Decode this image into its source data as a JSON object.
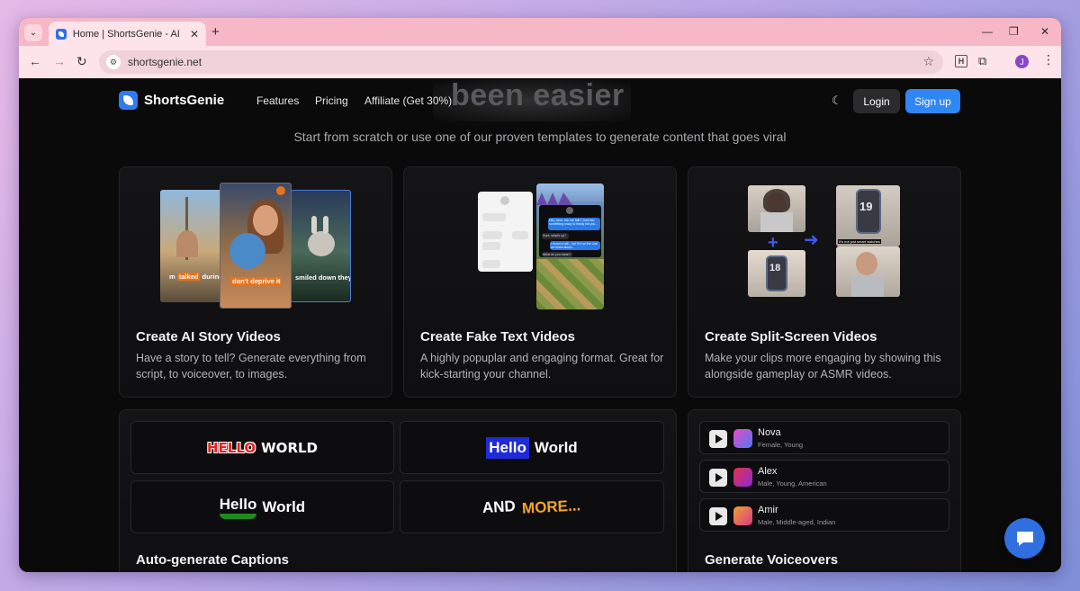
{
  "browser": {
    "tab_title": "Home | ShortsGenie - AI Video",
    "url": "shortsgenie.net",
    "profile_initial": "J",
    "extension_letter": "H"
  },
  "nav": {
    "brand": "ShortsGenie",
    "links": [
      "Features",
      "Pricing",
      "Affiliate (Get 30%)"
    ],
    "login": "Login",
    "signup": "Sign up"
  },
  "hero": {
    "partial_heading": "been easier",
    "subtitle": "Start from scratch or use one of our proven templates to generate content that goes viral"
  },
  "features": [
    {
      "title": "Create AI Story Videos",
      "description": "Have a story to tell? Generate everything from script, to voiceover, to images."
    },
    {
      "title": "Create Fake Text Videos",
      "description": "A highly popuplar and engaging format. Great for kick-starting your channel."
    },
    {
      "title": "Create Split-Screen Videos",
      "description": "Make your clips more engaging by showing this alongside gameplay or ASMR videos."
    }
  ],
  "story_captions": {
    "left_pre": "m",
    "left_hl": "talked",
    "left_post": "during",
    "mid_hl": "don't deprive it",
    "right": "smiled down they"
  },
  "text_chat": {
    "header_time": "1:20",
    "bubbles": [
      "Hey Jane, can we talk? Just had something crazy to finally tell you...",
      "Sure, what's up?",
      "I found a will... but it's not the one we knew about...",
      "What do you mean?"
    ]
  },
  "split_screen": {
    "watch_time_top": "19",
    "watch_time_bottom": "18",
    "caption": "It's not just smart watches"
  },
  "captions": {
    "title": "Auto-generate Captions",
    "styles": [
      {
        "word1": "HELLO",
        "word2": "WORLD"
      },
      {
        "word1": "Hello",
        "word2": "World"
      },
      {
        "word1": "Hello",
        "word2": "World"
      },
      {
        "word1": "AND",
        "word2": "MORE..."
      }
    ]
  },
  "voiceovers": {
    "title": "Generate Voiceovers",
    "voices": [
      {
        "name": "Nova",
        "desc": "Female, Young"
      },
      {
        "name": "Alex",
        "desc": "Male, Young, American"
      },
      {
        "name": "Amir",
        "desc": "Male, Middle-aged, Indian"
      }
    ]
  },
  "colors": {
    "accent": "#2f86f5",
    "background": "#0a0a0b",
    "highlight_orange": "#e8731c",
    "caption_red": "#e62020",
    "caption_green": "#1f8a1f",
    "caption_yellow": "#f5a623"
  }
}
